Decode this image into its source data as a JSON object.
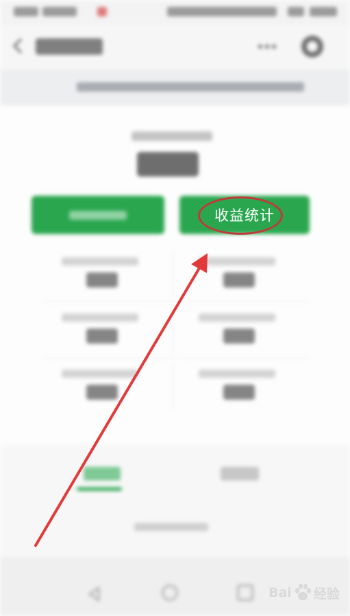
{
  "main": {
    "earnings_stats_label": "收益统计"
  },
  "watermark": {
    "brand_left": "Bai",
    "brand_right": "经验",
    "icon": "paw-icon"
  },
  "annotation": {
    "circle_color": "#c03a3a",
    "arrow_color": "#e23a3a"
  },
  "colors": {
    "accent_green": "#2aa64f"
  }
}
